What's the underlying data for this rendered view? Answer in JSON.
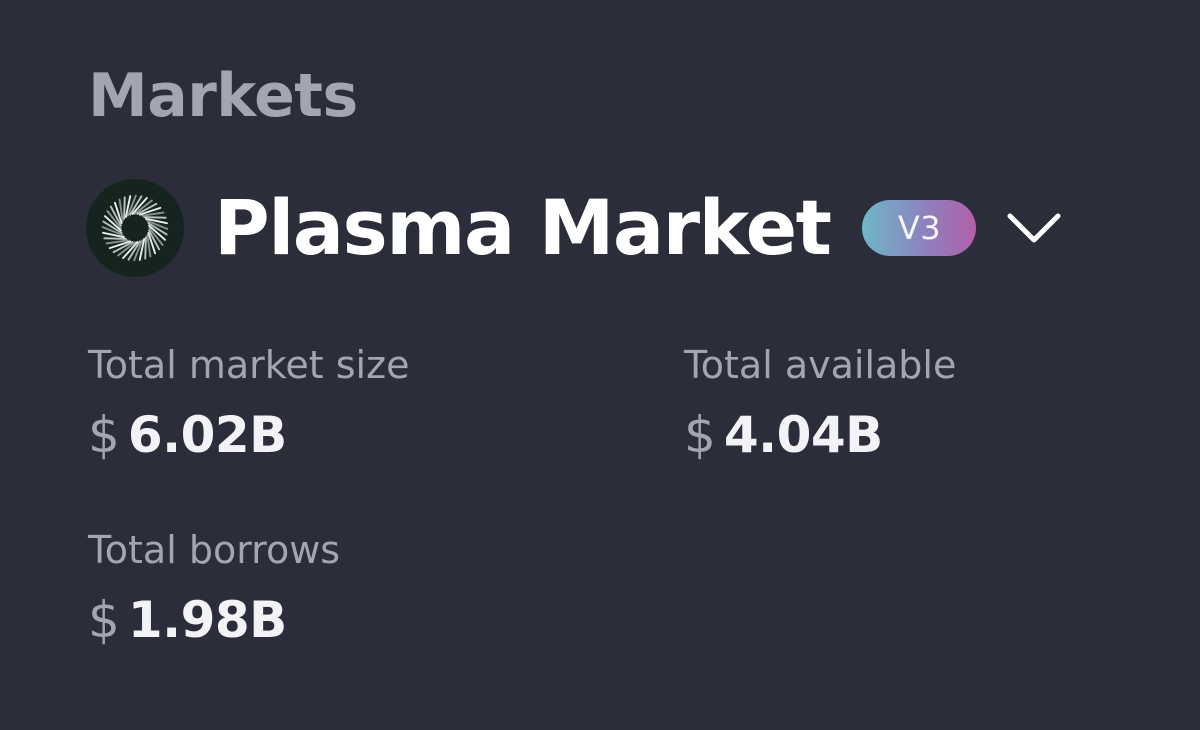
{
  "header": {
    "eyebrow": "Markets",
    "market_name": "Plasma Market",
    "version_badge": "V3",
    "logo_icon": "plasma-logo-icon",
    "dropdown_icon": "chevron-down-icon"
  },
  "stats": [
    {
      "label": "Total market size",
      "currency": "$",
      "value": "6.02B"
    },
    {
      "label": "Total available",
      "currency": "$",
      "value": "4.04B"
    },
    {
      "label": "Total borrows",
      "currency": "$",
      "value": "1.98B"
    }
  ],
  "colors": {
    "background": "#2b2d3b",
    "muted_text": "#a4a5b3",
    "primary_text": "#ffffff",
    "logo_background": "#15241f",
    "badge_gradient_start": "#6fb8c6",
    "badge_gradient_mid": "#8c82be",
    "badge_gradient_end": "#b35fa8"
  }
}
